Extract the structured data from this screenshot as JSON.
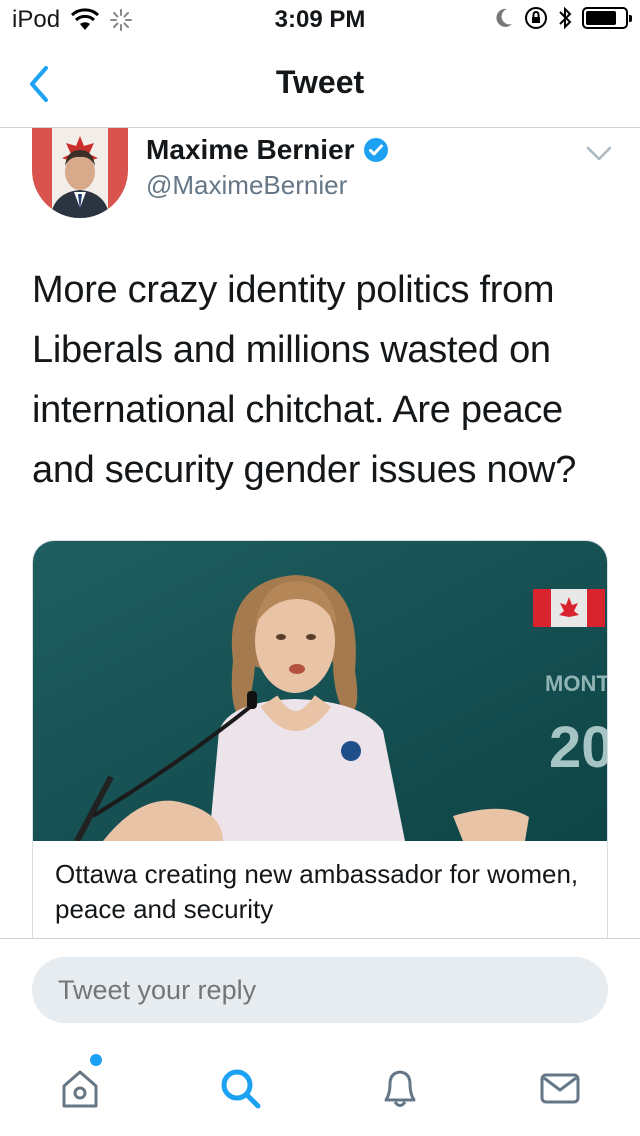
{
  "status_bar": {
    "device": "iPod",
    "time": "3:09 PM"
  },
  "nav": {
    "title": "Tweet"
  },
  "tweet": {
    "author_name": "Maxime Bernier",
    "author_handle": "@MaximeBernier",
    "text": "More crazy identity politics from Liberals and millions wasted on international chitchat. Are peace and security gender issues now?",
    "verified": true
  },
  "card": {
    "title": "Ottawa creating new ambassador for women, peace and security",
    "image_text_year": "20",
    "image_text_city": "MONT"
  },
  "reply": {
    "placeholder": "Tweet your reply"
  },
  "tabs": [
    {
      "name": "home",
      "has_notification": true
    },
    {
      "name": "search",
      "active": true
    },
    {
      "name": "notifications"
    },
    {
      "name": "messages"
    }
  ],
  "colors": {
    "accent": "#1da1f2",
    "text_primary": "#14171a",
    "text_secondary": "#657786",
    "divider": "#cfd4d9",
    "reply_bg": "#e6ecf0"
  }
}
